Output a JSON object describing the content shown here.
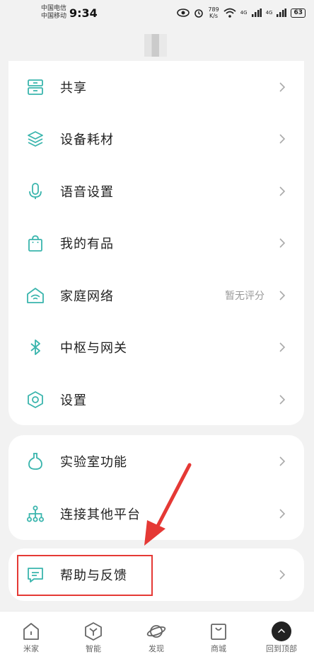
{
  "status_bar": {
    "carrier_1": "中国电信",
    "carrier_2": "中国移动",
    "time": "9:34",
    "net_speed": "789",
    "net_speed_unit": "K/s",
    "signal_1": "4G",
    "signal_2": "4G",
    "battery": "63"
  },
  "menu_group_1": [
    {
      "label": "共享",
      "icon": "share-cabinet-icon"
    },
    {
      "label": "设备耗材",
      "icon": "layers-icon"
    },
    {
      "label": "语音设置",
      "icon": "microphone-icon"
    },
    {
      "label": "我的有品",
      "icon": "shopping-bag-icon"
    },
    {
      "label": "家庭网络",
      "icon": "home-wifi-icon",
      "sub": "暂无评分"
    },
    {
      "label": "中枢与网关",
      "icon": "bluetooth-icon"
    },
    {
      "label": "设置",
      "icon": "settings-hexagon-icon"
    }
  ],
  "menu_group_2": [
    {
      "label": "实验室功能",
      "icon": "flask-icon"
    },
    {
      "label": "连接其他平台",
      "icon": "network-tree-icon"
    }
  ],
  "menu_group_3": [
    {
      "label": "帮助与反馈",
      "icon": "feedback-message-icon"
    }
  ],
  "bottom_nav": [
    {
      "label": "米家",
      "icon": "home-icon"
    },
    {
      "label": "智能",
      "icon": "smart-hexagon-icon"
    },
    {
      "label": "发现",
      "icon": "planet-icon"
    },
    {
      "label": "商城",
      "icon": "shop-bag-icon"
    },
    {
      "label": "回到顶部",
      "icon": "back-to-top-icon"
    }
  ],
  "colors": {
    "accent": "#3ab5ad",
    "annotation": "#e53935"
  }
}
